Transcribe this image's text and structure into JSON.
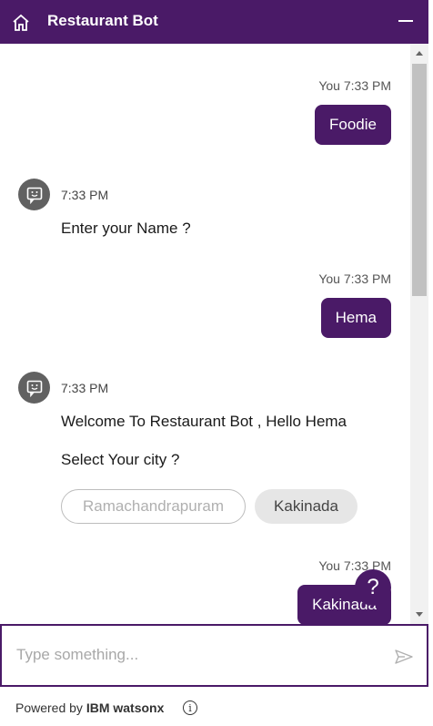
{
  "header": {
    "title": "Restaurant Bot",
    "home_icon": "home-icon",
    "minimize_icon": "minimize-icon"
  },
  "messages": {
    "m1": {
      "sender": "You",
      "time": "7:33 PM",
      "text": "Foodie"
    },
    "m2": {
      "time": "7:33 PM",
      "text": "Enter your Name ?"
    },
    "m3": {
      "sender": "You",
      "time": "7:33 PM",
      "text": "Hema"
    },
    "m4": {
      "time": "7:33 PM",
      "text1": "Welcome To Restaurant Bot , Hello Hema",
      "text2": "Select Your city ?",
      "options": [
        "Ramachandrapuram",
        "Kakinada"
      ]
    },
    "m5": {
      "sender": "You",
      "time": "7:33 PM",
      "text": "Kakinada"
    }
  },
  "help_button": {
    "label": "?"
  },
  "input": {
    "placeholder": "Type something..."
  },
  "footer": {
    "powered_by": "Powered by",
    "brand": "IBM watsonx"
  },
  "colors": {
    "primary": "#4a1a67",
    "avatar": "#616161",
    "option_selected": "#e6e6e6"
  }
}
